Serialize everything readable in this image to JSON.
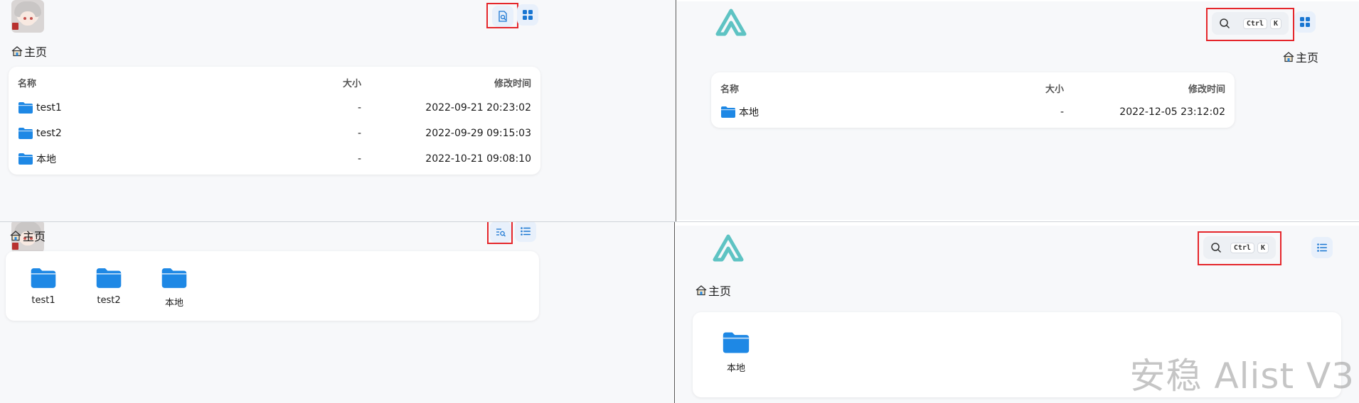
{
  "breadcrumb": {
    "home_label": "主页"
  },
  "list_view": {
    "headers": {
      "name": "名称",
      "size": "大小",
      "modified": "修改时间"
    },
    "left_rows": [
      {
        "name": "test1",
        "size": "-",
        "modified": "2022-09-21 20:23:02"
      },
      {
        "name": "test2",
        "size": "-",
        "modified": "2022-09-29 09:15:03"
      },
      {
        "name": "本地",
        "size": "-",
        "modified": "2022-10-21 09:08:10"
      }
    ],
    "right_rows": [
      {
        "name": "本地",
        "size": "-",
        "modified": "2022-12-05 23:12:02"
      }
    ]
  },
  "grid_view": {
    "left_items": [
      "test1",
      "test2",
      "本地"
    ],
    "right_items": [
      "本地"
    ]
  },
  "search": {
    "key1": "Ctrl",
    "key2": "K"
  },
  "watermark": "安稳 Alist V3",
  "colors": {
    "folder": "#1e88e5",
    "accent": "#1976d2",
    "highlight": "#e5262b",
    "logo": "#5ec3c3"
  },
  "icons": {
    "search_files": "search-file-icon",
    "grid_toggle": "grid-icon",
    "list_toggle": "list-icon",
    "home": "home-icon",
    "folder": "folder-icon",
    "magnifier": "search-icon"
  }
}
